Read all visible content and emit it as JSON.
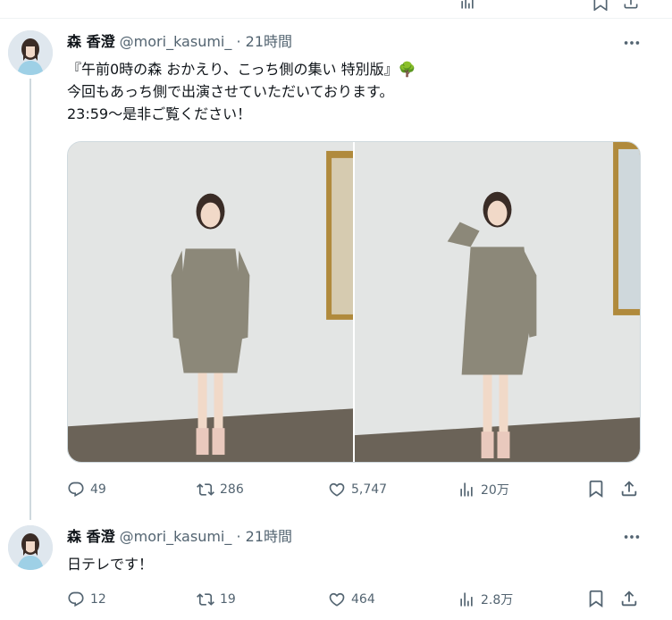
{
  "tweets": [
    {
      "name": "森 香澄",
      "handle": "@mori_kasumi_",
      "separator": "·",
      "time": "21時間",
      "lines": [
        "『午前0時の森 おかえり、こっち側の集い 特別版』🌳",
        "今回もあっち側で出演させていただいております。",
        "23:59〜是非ご覧ください！"
      ],
      "photo_count": 2,
      "stats": {
        "replies": "49",
        "reposts": "286",
        "likes": "5,747",
        "views": "20万"
      }
    },
    {
      "name": "森 香澄",
      "handle": "@mori_kasumi_",
      "separator": "·",
      "time": "21時間",
      "lines": [
        "日テレです！"
      ],
      "stats": {
        "replies": "12",
        "reposts": "19",
        "likes": "464",
        "views": "2.8万"
      }
    }
  ],
  "icons": {
    "more": "more-icon",
    "reply": "reply-icon",
    "repost": "repost-icon",
    "like": "like-icon",
    "views": "views-icon",
    "bookmark": "bookmark-icon",
    "share": "share-icon"
  },
  "colors": {
    "text": "#0f1419",
    "secondary": "#536471",
    "border": "#cfd9de"
  }
}
